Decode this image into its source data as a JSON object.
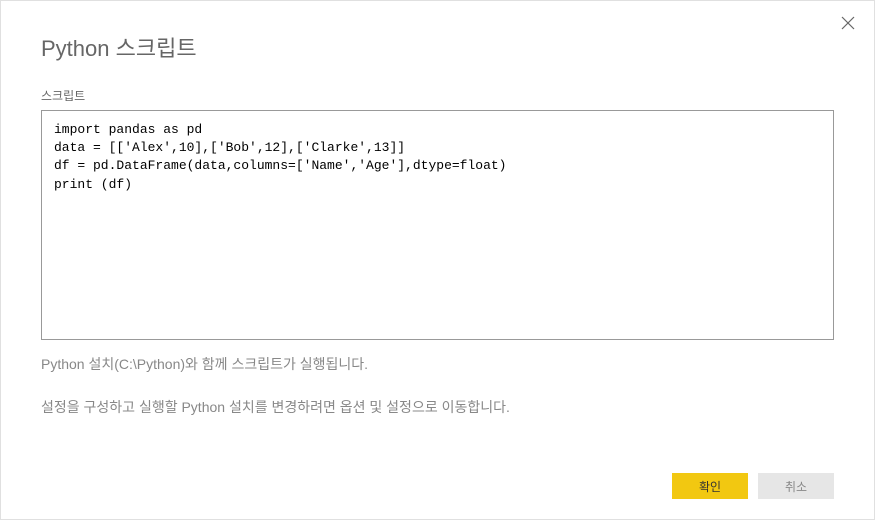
{
  "dialog": {
    "title": "Python 스크립트",
    "script_label": "스크립트",
    "script_content": "import pandas as pd\ndata = [['Alex',10],['Bob',12],['Clarke',13]]\ndf = pd.DataFrame(data,columns=['Name','Age'],dtype=float)\nprint (df)",
    "info_line1": "Python 설치(C:\\Python)와 함께 스크립트가 실행됩니다.",
    "info_line2": "설정을 구성하고 실행할 Python 설치를 변경하려면 옵션 및 설정으로 이동합니다.",
    "ok_label": "확인",
    "cancel_label": "취소"
  }
}
